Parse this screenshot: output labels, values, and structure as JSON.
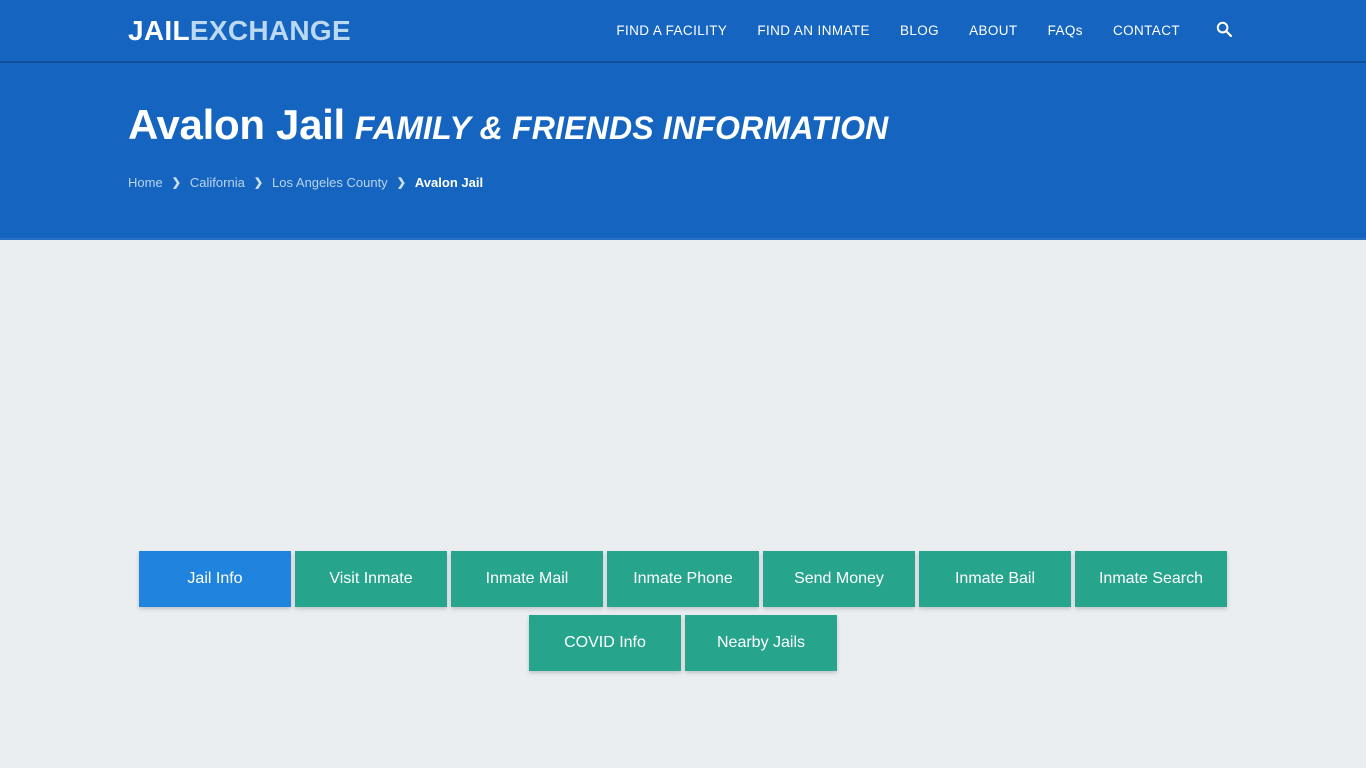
{
  "header": {
    "brand": {
      "part1": "JAIL",
      "part2": "EXCHANGE"
    },
    "nav": [
      {
        "label": "FIND A FACILITY"
      },
      {
        "label": "FIND AN INMATE"
      },
      {
        "label": "BLOG"
      },
      {
        "label": "ABOUT"
      },
      {
        "label": "FAQs"
      },
      {
        "label": "CONTACT"
      }
    ],
    "search_icon": "search-icon"
  },
  "hero": {
    "title_main": "Avalon Jail",
    "title_sub": "FAMILY & FRIENDS INFORMATION",
    "breadcrumb": [
      {
        "label": "Home",
        "current": false
      },
      {
        "label": "California",
        "current": false
      },
      {
        "label": "Los Angeles County",
        "current": false
      },
      {
        "label": "Avalon Jail",
        "current": true
      }
    ],
    "breadcrumb_separator": "❯"
  },
  "main": {
    "nav_buttons_row1": [
      {
        "label": "Jail Info",
        "active": true
      },
      {
        "label": "Visit Inmate",
        "active": false
      },
      {
        "label": "Inmate Mail",
        "active": false
      },
      {
        "label": "Inmate Phone",
        "active": false
      },
      {
        "label": "Send Money",
        "active": false
      },
      {
        "label": "Inmate Bail",
        "active": false
      },
      {
        "label": "Inmate Search",
        "active": false
      }
    ],
    "nav_buttons_row2": [
      {
        "label": "COVID Info",
        "active": false
      },
      {
        "label": "Nearby Jails",
        "active": false
      }
    ]
  },
  "colors": {
    "header_blue": "#1565c0",
    "hero_blue": "#1565c0",
    "body_bg": "#eaeef1",
    "button_teal": "#27a58c",
    "button_active_blue": "#2084de",
    "brand_accent": "#bcd9f2"
  }
}
